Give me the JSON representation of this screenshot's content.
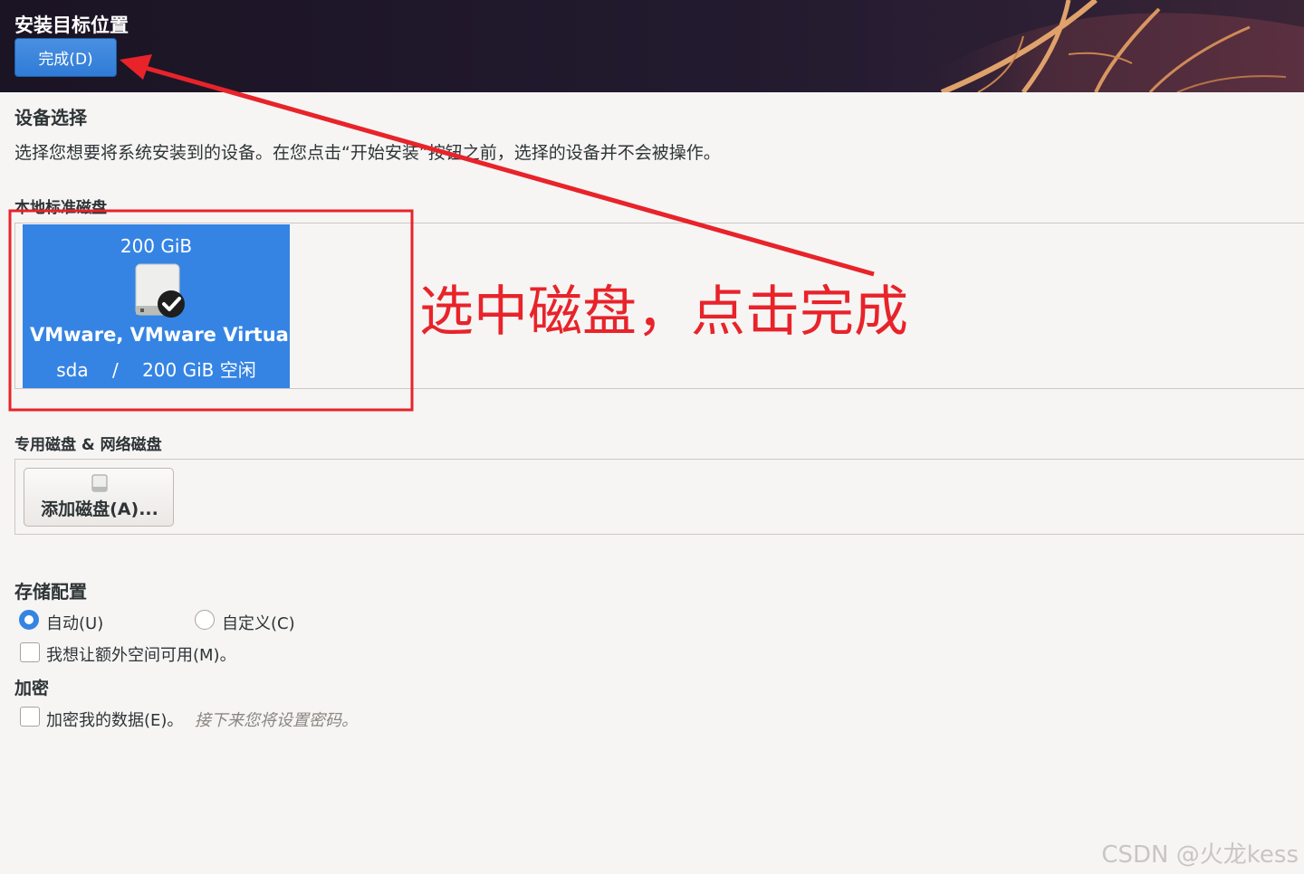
{
  "header": {
    "title": "安装目标位置",
    "done_label": "完成(D)"
  },
  "device_selection": {
    "title": "设备选择",
    "description": "选择您想要将系统安装到的设备。在您点击“开始安装”按钮之前，选择的设备并不会被操作。"
  },
  "local_disks": {
    "heading": "本地标准磁盘",
    "disk": {
      "size": "200 GiB",
      "name": "VMware, VMware Virtual S",
      "device": "sda",
      "separator": "/",
      "free": "200 GiB 空闲",
      "icon": "harddisk-checked-icon",
      "selected": true
    }
  },
  "special_disks": {
    "heading": "专用磁盘 & 网络磁盘",
    "add_label": "添加磁盘(A)...",
    "add_icon": "harddisk-icon"
  },
  "storage_config": {
    "title": "存储配置",
    "auto_label": "自动(U)",
    "custom_label": "自定义(C)",
    "selected": "auto",
    "extra_space_label": "我想让额外空间可用(M)。"
  },
  "encryption": {
    "title": "加密",
    "encrypt_label": "加密我的数据(E)。",
    "hint": "接下来您将设置密码。"
  },
  "annotation": {
    "text": "选中磁盘，点击完成",
    "color": "#e8232a"
  },
  "watermark": "CSDN @火龙kess",
  "colors": {
    "accent": "#3584e4",
    "header_bg": "#1b1424"
  }
}
